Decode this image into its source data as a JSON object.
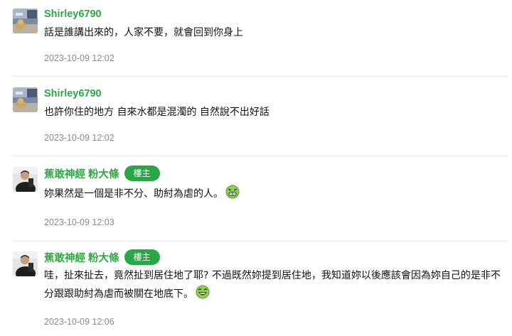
{
  "comments": [
    {
      "username": "Shirley6790",
      "badge": "",
      "text": "話是誰講出來的，人家不要，就會回到你身上",
      "timestamp": "2023-10-09 12:02",
      "avatar_icon": "photo-avatar-cat-icon",
      "emoji_icon": ""
    },
    {
      "username": "Shirley6790",
      "badge": "",
      "text": "也許你住的地方 自來水都是混濁的 自然說不出好話",
      "timestamp": "2023-10-09 12:02",
      "avatar_icon": "photo-avatar-cat-icon",
      "emoji_icon": ""
    },
    {
      "username": "蕉敢神經 粉大條",
      "badge": "樓主",
      "text": "妳果然是一個是非不分、助紂為虐的人。",
      "timestamp": "2023-10-09 12:03",
      "avatar_icon": "photo-avatar-person-icon",
      "emoji_icon": "grinning-green-face-emoji"
    },
    {
      "username": "蕉敢神經 粉大條",
      "badge": "樓主",
      "text": "哇，扯來扯去，竟然扯到居住地了耶? 不過既然妳提到居住地，我知道妳以後應該會因為妳自己的是非不分跟跟助紂為虐而被關在地底下。",
      "timestamp": "2023-10-09 12:06",
      "avatar_icon": "photo-avatar-person-icon",
      "emoji_icon": "laughing-green-face-emoji"
    }
  ],
  "colors": {
    "username": "#2aaa3f",
    "badge_bg": "#27a844",
    "timestamp": "#8a8a8a",
    "divider": "#e6e6e6"
  }
}
